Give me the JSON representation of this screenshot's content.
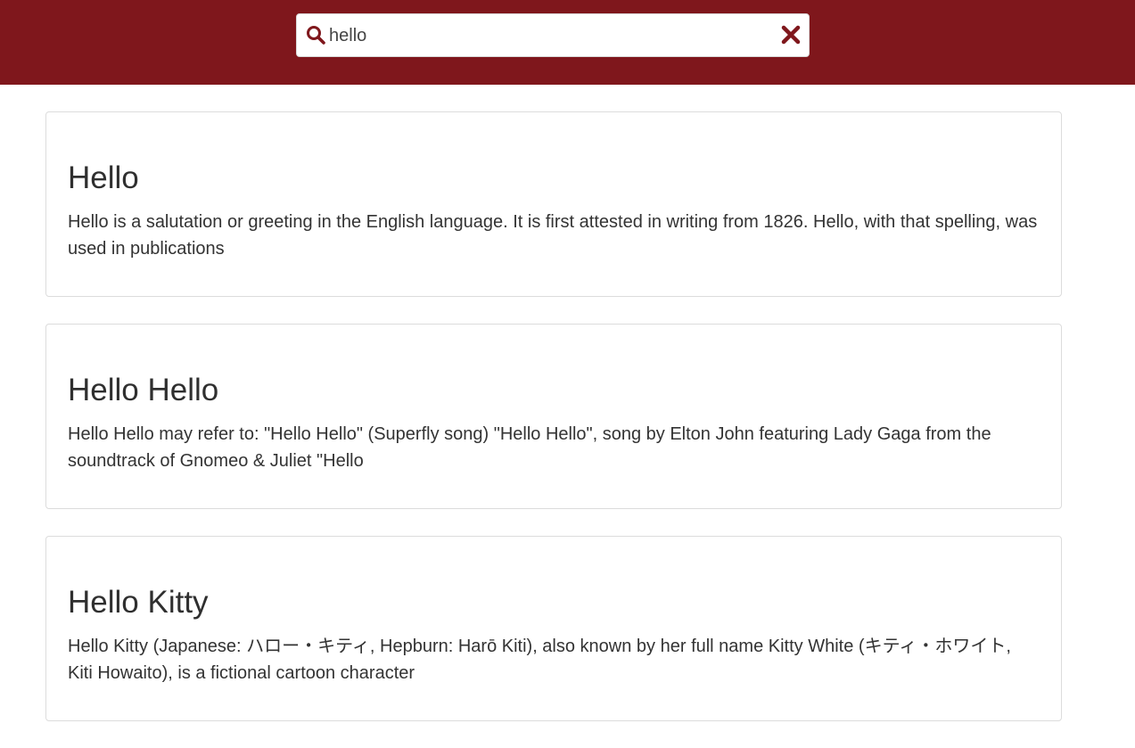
{
  "search": {
    "value": "hello",
    "placeholder": ""
  },
  "icons": {
    "search": "search-icon",
    "clear": "close-icon"
  },
  "colors": {
    "header_bg": "#7f171c",
    "accent": "#7f171c"
  },
  "results": [
    {
      "title": "Hello",
      "snippet": "Hello is a salutation or greeting in the English language. It is first attested in writing from 1826. Hello, with that spelling, was used in publications"
    },
    {
      "title": "Hello Hello",
      "snippet": "Hello Hello may refer to: \"Hello Hello\" (Superfly song) \"Hello Hello\", song by Elton John featuring Lady Gaga from the soundtrack of Gnomeo & Juliet \"Hello"
    },
    {
      "title": "Hello Kitty",
      "snippet": "Hello Kitty (Japanese: ハロー・キティ, Hepburn: Harō Kiti), also known by her full name Kitty White (キティ・ホワイト, Kiti Howaito), is a fictional cartoon character"
    }
  ]
}
